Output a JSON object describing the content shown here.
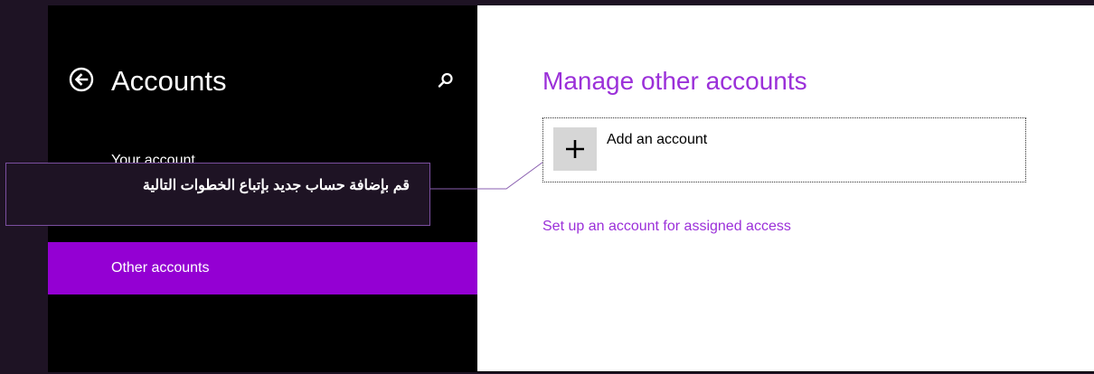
{
  "left_pane": {
    "title": "Accounts",
    "nav_items": [
      {
        "label": "Your account",
        "selected": false
      },
      {
        "label": "Other accounts",
        "selected": true
      }
    ],
    "icons": {
      "back": "back-circle-arrow-icon",
      "search": "search-icon"
    }
  },
  "callout": {
    "text": "قم بإضافة حساب جديد بإتباع الخطوات التالية"
  },
  "main": {
    "title": "Manage other accounts",
    "add_account": {
      "label": "Add an account",
      "icon": "plus-icon"
    },
    "assigned_access_link": "Set up an account for assigned access"
  },
  "colors": {
    "accent": "#9400d3",
    "accent_text": "#9b30d9",
    "sidebar_bg": "#000000",
    "frame_bg": "#1e1324",
    "content_bg": "#ffffff"
  }
}
